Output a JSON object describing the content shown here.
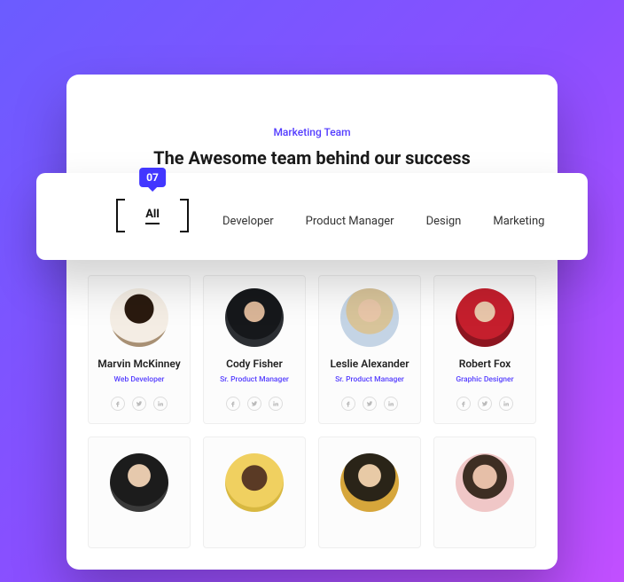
{
  "header": {
    "eyebrow": "Marketing Team",
    "heading": "The Awesome team behind our success"
  },
  "filter": {
    "count_badge": "07",
    "all_label": "All",
    "tabs": {
      "developer": "Developer",
      "product_manager": "Product Manager",
      "design": "Design",
      "marketing": "Marketing"
    }
  },
  "members": [
    {
      "name": "Marvin McKinney",
      "role": "Web Developer"
    },
    {
      "name": "Cody Fisher",
      "role": "Sr. Product Manager"
    },
    {
      "name": "Leslie Alexander",
      "role": "Sr. Product Manager"
    },
    {
      "name": "Robert Fox",
      "role": "Graphic Designer"
    },
    {
      "name": "",
      "role": ""
    },
    {
      "name": "",
      "role": ""
    },
    {
      "name": "",
      "role": ""
    },
    {
      "name": "",
      "role": ""
    }
  ],
  "colors": {
    "accent": "#533cff",
    "badge": "#4237ff"
  }
}
